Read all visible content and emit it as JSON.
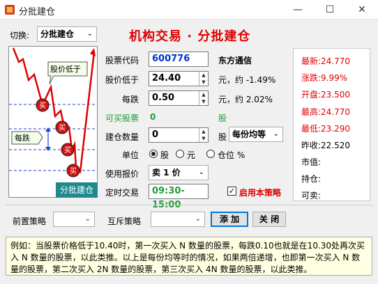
{
  "window": {
    "title": "分批建仓",
    "min": "—",
    "max": "☐",
    "close": "✕"
  },
  "header": {
    "switch_label": "切换:",
    "switch_value": "分批建仓",
    "big_title": "机构交易 · 分批建仓"
  },
  "chart": {
    "bubble_price_low": "股价低于",
    "bubble_each_drop": "每跌",
    "buy_marker": "买",
    "caption": "分批建仓"
  },
  "form": {
    "code_label": "股票代码",
    "code_value": "600776",
    "stock_name": "东方通信",
    "price_below_label": "股价低于",
    "price_below_value": "24.40",
    "price_below_note": "元，约 -1.49%",
    "each_drop_label": "每跌",
    "each_drop_value": "0.50",
    "each_drop_note": "元，约 2.02%",
    "buyable_label": "可买股票",
    "buyable_value": "0",
    "buyable_unit": "股",
    "qty_label": "建仓数量",
    "qty_value": "0",
    "qty_unit": "股",
    "qty_mode": "每份均等",
    "unit_label": "单位",
    "unit_options": [
      "股",
      "元",
      "仓位 %"
    ],
    "unit_selected": 0,
    "price_type_label": "使用报价",
    "price_type_value": "卖 1 价",
    "timed_label": "定时交易",
    "timed_value": "09:30-15:00",
    "enable_label": "启用本策略",
    "enable_checked": true
  },
  "quote": {
    "latest": "最新:24.770",
    "change": "涨跌:9.99%",
    "open": "开盘:23.500",
    "high": "最高:24.770",
    "low": "最低:23.290",
    "prev_close": "昨收:22.520",
    "market_value": "市值:",
    "holding": "持仓:",
    "sellable": "可卖:"
  },
  "bottom": {
    "pre_label": "前置策略",
    "pre_value": "",
    "mutex_label": "互斥策略",
    "mutex_value": "",
    "add_button": "添 加",
    "close_button": "关 闭"
  },
  "note": "例如：当股票价格低于10.40时，第一次买入 N 数量的股票，每跌0.10也就是在10.30处再次买入 N 数量的股票，以此类推。以上是每份均等时的情况，如果两倍递增，也即第一次买入 N 数量的股票，第二次买入 2N 数量的股票，第三次买入 4N 数量的股票，以此类推。",
  "colors": {
    "red": "#e00000",
    "green": "#1f9d37",
    "blue": "#0033cc",
    "teal": "#1e8a8e",
    "note_bg": "#ffffe1"
  }
}
